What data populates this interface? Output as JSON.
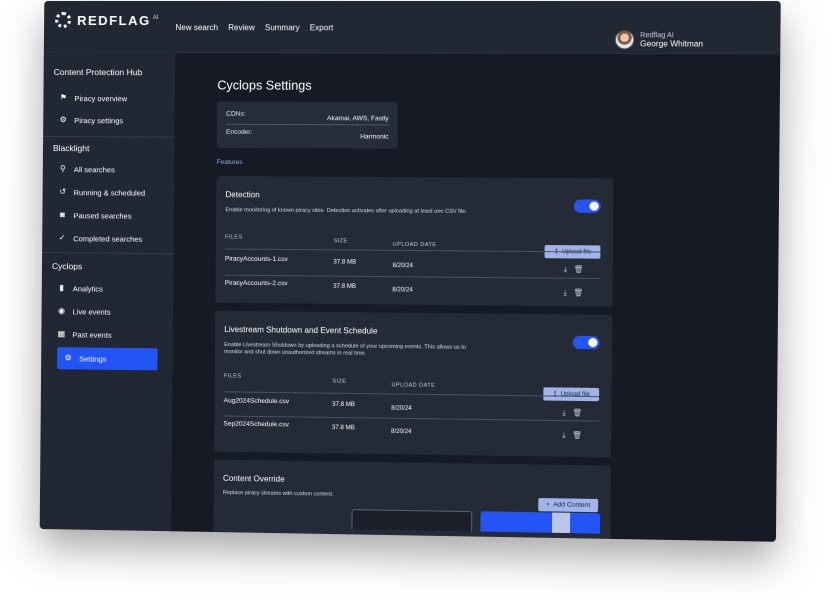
{
  "brand": {
    "name": "REDFLAG",
    "suffix": "AI"
  },
  "nav": [
    "New search",
    "Review",
    "Summary",
    "Export"
  ],
  "user": {
    "org": "Redflag AI",
    "name": "George Whitman"
  },
  "sidebar": {
    "hub_title": "Content Protection Hub",
    "hub_items": [
      {
        "label": "Piracy overview",
        "icon": "flag-icon"
      },
      {
        "label": "Piracy settings",
        "icon": "gears-icon"
      }
    ],
    "blacklight_title": "Blacklight",
    "blacklight_items": [
      {
        "label": "All searches",
        "icon": "search-icon"
      },
      {
        "label": "Running & scheduled",
        "icon": "history-icon"
      },
      {
        "label": "Paused searches",
        "icon": "pause-icon"
      },
      {
        "label": "Completed searches",
        "icon": "check-circle-icon"
      }
    ],
    "cyclops_title": "Cyclops",
    "cyclops_items": [
      {
        "label": "Analytics",
        "icon": "bar-chart-icon"
      },
      {
        "label": "Live events",
        "icon": "broadcast-icon"
      },
      {
        "label": "Past events",
        "icon": "calendar-icon"
      },
      {
        "label": "Settings",
        "icon": "gears-icon",
        "active": true
      }
    ]
  },
  "main": {
    "title": "Cyclops Settings",
    "info": {
      "cdns_label": "CDNs:",
      "cdns_value": "Akamai, AWS, Fastly",
      "encoder_label": "Encoder:",
      "encoder_value": "Harmonic"
    },
    "features_label": "Features",
    "detection": {
      "title": "Detection",
      "desc": "Enable monitoring of known piracy sites. Detection activates after uploading at least one CSV file.",
      "enabled": true,
      "col_files": "FILES",
      "col_size": "SIZE",
      "col_date": "UPLOAD DATE",
      "upload_label": "Upload file",
      "files": [
        {
          "name": "PiracyAccounts-1.csv",
          "size": "37.8 MB",
          "date": "8/20/24"
        },
        {
          "name": "PiracyAccounts-2.csv",
          "size": "37.8 MB",
          "date": "8/20/24"
        }
      ]
    },
    "livestream": {
      "title": "Livestream Shutdown and Event Schedule",
      "desc": "Enable Livestream Shutdown by uploading a schedule of your upcoming events. This allows us to monitor and shut down unauthorized streams in real time.",
      "enabled": true,
      "col_files": "FILES",
      "col_size": "SIZE",
      "col_date": "UPLOAD DATE",
      "upload_label": "Upload file",
      "files": [
        {
          "name": "Aug2024Schedule.csv",
          "size": "37.8 MB",
          "date": "8/20/24"
        },
        {
          "name": "Sep2024Schedule.csv",
          "size": "37.8 MB",
          "date": "8/20/24"
        }
      ]
    },
    "override": {
      "title": "Content Override",
      "desc": "Replace piracy streams with custom content.",
      "add_label": "Add Content"
    }
  },
  "colors": {
    "accent": "#2355f6",
    "button": "#9fb5e9",
    "bg": "#161a25",
    "card": "#252a37"
  }
}
